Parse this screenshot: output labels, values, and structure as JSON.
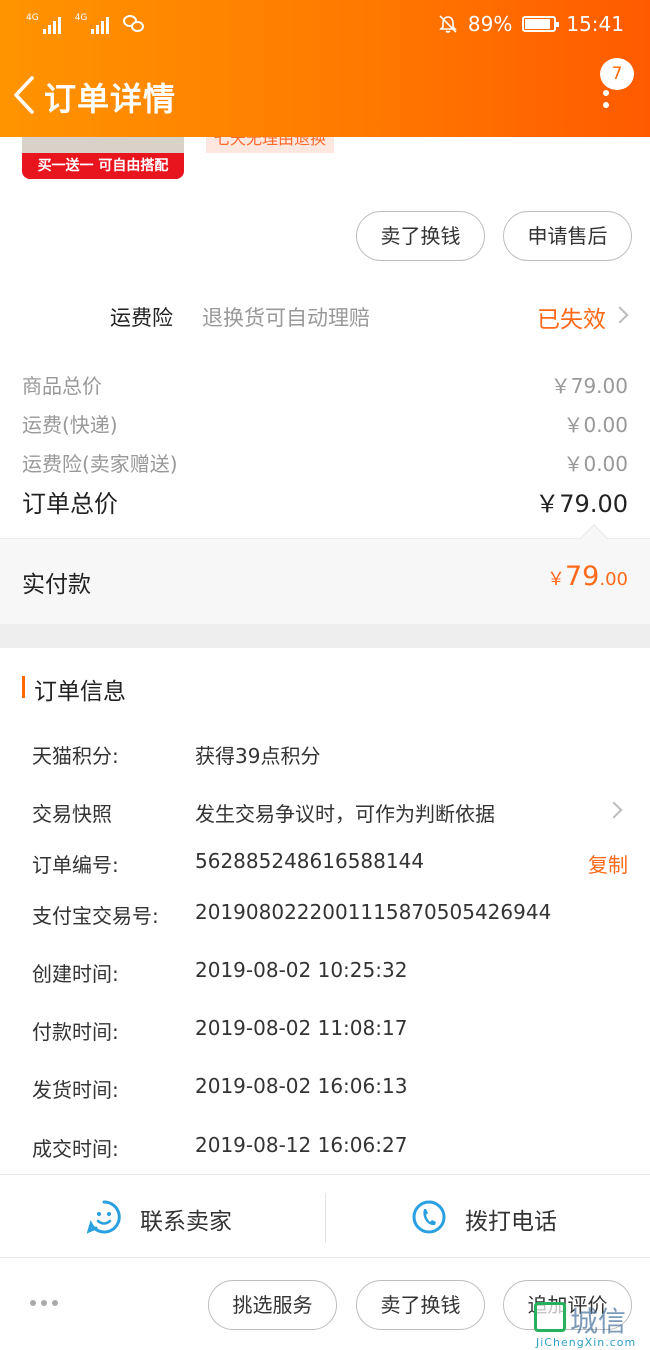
{
  "status_bar": {
    "signal1_label": "4G",
    "signal2_label": "4G",
    "battery_percent": "89%",
    "battery_level": 0.89,
    "time": "15:41"
  },
  "header": {
    "title": "订单详情",
    "message_count": "7"
  },
  "product": {
    "promo_tag": "买一送一 可自由搭配",
    "return_tag": "七天无理由退换"
  },
  "item_actions": {
    "sell_label": "卖了换钱",
    "after_sale_label": "申请售后"
  },
  "insurance": {
    "name": "运费险",
    "desc": "退换货可自动理赔",
    "status": "已失效"
  },
  "prices": {
    "rows": [
      {
        "label": "商品总价",
        "value": "￥79.00"
      },
      {
        "label": "运费(快递)",
        "value": "￥0.00"
      },
      {
        "label": "运费险(卖家赠送)",
        "value": "￥0.00"
      }
    ],
    "total_label": "订单总价",
    "total_value": "￥79.00",
    "paid_label": "实付款",
    "paid_currency": "￥",
    "paid_int": "79",
    "paid_dec": ".00"
  },
  "order_info": {
    "section_title": "订单信息",
    "rows": [
      {
        "label": "天猫积分:",
        "value": "获得39点积分"
      },
      {
        "label": "交易快照",
        "value": "发生交易争议时，可作为判断依据"
      },
      {
        "label": "订单编号:",
        "value": "562885248616588144",
        "action": "复制"
      },
      {
        "label": "支付宝交易号:",
        "value": "2019080222001115870505426944"
      },
      {
        "label": "创建时间:",
        "value": "2019-08-02 10:25:32"
      },
      {
        "label": "付款时间:",
        "value": "2019-08-02 11:08:17"
      },
      {
        "label": "发货时间:",
        "value": "2019-08-02 16:06:13"
      },
      {
        "label": "成交时间:",
        "value": "2019-08-12 16:06:27"
      }
    ]
  },
  "contact": {
    "seller_label": "联系卖家",
    "phone_label": "拨打电话"
  },
  "bottom_actions": {
    "select_service": "挑选服务",
    "sell": "卖了换钱",
    "add_review": "追加评价"
  },
  "watermark": {
    "text": "城信",
    "sub": "JiChengXin.com"
  },
  "colors": {
    "header_start": "#ff9400",
    "header_end": "#ff5a00",
    "accent": "#ff6a1a",
    "contact_icon": "#2aa0e0"
  }
}
